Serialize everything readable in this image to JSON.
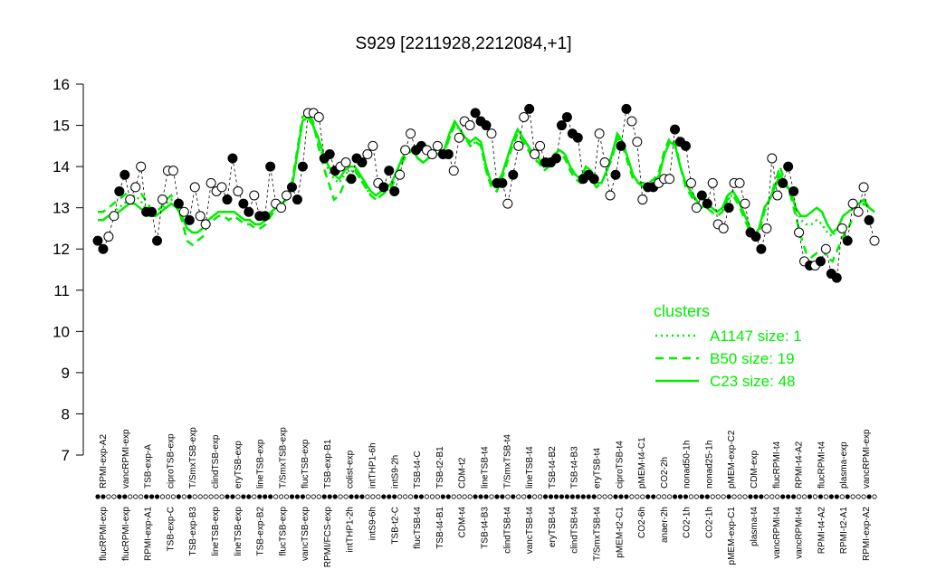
{
  "chart_data": {
    "type": "line",
    "title": "S929 [2211928,2212084,+1]",
    "xlabel": "",
    "ylabel": "",
    "ylim": [
      7,
      16
    ],
    "yticks": [
      7,
      8,
      9,
      10,
      11,
      12,
      13,
      14,
      15,
      16
    ],
    "grid": false,
    "legend_position": "right",
    "legend": {
      "title": "clusters",
      "items": [
        {
          "label": "A1147 size: 1",
          "style": "dotted"
        },
        {
          "label": "B50 size: 19",
          "style": "dashed"
        },
        {
          "label": "C23 size: 48",
          "style": "solid"
        }
      ]
    },
    "colors": {
      "line": "#00ee00",
      "text": "#000000",
      "point_filled": "#000000",
      "point_open": "#ffffff"
    },
    "top_tick_labels": [
      "RPMI-exp-A2",
      "vancRPMI-exp",
      "TSB-exp-A",
      "ciproTSB-exp",
      "T/SmxTSB-exp",
      "clindTSB-exp",
      "eryTSB-exp",
      "lineTSB-exp",
      "T/SmxTSB-exp",
      "flucTSB-exp",
      "TSB-exp-B1",
      "colist-exp",
      "intTHP1-6h",
      "intS9-2h",
      "TSB-t4-C",
      "TSB-t2-B1",
      "CDM-t2",
      "lineTSB-t4",
      "T/SmxTSB-t4",
      "lineTSB-t4",
      "TSB-t4-B2",
      "TSB-t4-B3",
      "eryTSB-t4",
      "ciproTSB-t4",
      "pMEM-t4-C1",
      "CO2-2h",
      "nonad50-1h",
      "nonad25-1h",
      "pMEM-exp-C2",
      "CDM-exp",
      "flucRPMI-t4",
      "RPMI-t4-A2",
      "flucRPMI-t4",
      "plasma-exp",
      "vancRPMI-exp"
    ],
    "bottom_tick_labels": [
      "flucRPMI-exp",
      "flucRPMI-exp",
      "RPMI-exp-A1",
      "TSB-exp-C",
      "TSB-exp-B3",
      "lineTSB-exp",
      "lineTSB-exp",
      "TSB-exp-B2",
      "flucTSB-exp",
      "vancTSB-exp",
      "RPMI/FCS-exp",
      "intTHP1-2h",
      "intS9-6h",
      "TSB-t2-C",
      "flucTSB-t4",
      "TSB-t4-B1",
      "CDM-t4",
      "TSB-t4-B3",
      "clindTSB-t4",
      "vancTSB-t4",
      "eryTSB-t4",
      "clindTSB-t4",
      "T/SmxTSB-t4",
      "pMEM-t2-C1",
      "CO2-6h",
      "anaer-2h",
      "CO2-1h",
      "CO2-1h",
      "pMEM-exp-C1",
      "plasma-t4",
      "vancRPMI-t4",
      "vancRPMI-t4",
      "RPMI-t4-A2",
      "RPMI-t2-A1",
      "RPMI-exp-A2"
    ],
    "points": [
      {
        "y": 12.2,
        "filled": true
      },
      {
        "y": 12.0,
        "filled": true
      },
      {
        "y": 12.3,
        "filled": false
      },
      {
        "y": 12.8,
        "filled": false
      },
      {
        "y": 13.4,
        "filled": true
      },
      {
        "y": 13.8,
        "filled": true
      },
      {
        "y": 13.2,
        "filled": false
      },
      {
        "y": 13.5,
        "filled": false
      },
      {
        "y": 14.0,
        "filled": false
      },
      {
        "y": 12.9,
        "filled": true
      },
      {
        "y": 12.9,
        "filled": true
      },
      {
        "y": 12.2,
        "filled": true
      },
      {
        "y": 13.2,
        "filled": false
      },
      {
        "y": 13.9,
        "filled": false
      },
      {
        "y": 13.9,
        "filled": false
      },
      {
        "y": 13.1,
        "filled": true
      },
      {
        "y": 12.9,
        "filled": false
      },
      {
        "y": 12.7,
        "filled": true
      },
      {
        "y": 13.5,
        "filled": false
      },
      {
        "y": 12.8,
        "filled": false
      },
      {
        "y": 12.6,
        "filled": false
      },
      {
        "y": 13.6,
        "filled": false
      },
      {
        "y": 13.4,
        "filled": false
      },
      {
        "y": 13.5,
        "filled": false
      },
      {
        "y": 13.2,
        "filled": true
      },
      {
        "y": 14.2,
        "filled": true
      },
      {
        "y": 13.4,
        "filled": false
      },
      {
        "y": 13.1,
        "filled": true
      },
      {
        "y": 12.9,
        "filled": true
      },
      {
        "y": 13.3,
        "filled": false
      },
      {
        "y": 12.8,
        "filled": true
      },
      {
        "y": 12.8,
        "filled": true
      },
      {
        "y": 14.0,
        "filled": true
      },
      {
        "y": 13.1,
        "filled": false
      },
      {
        "y": 13.0,
        "filled": false
      },
      {
        "y": 13.3,
        "filled": false
      },
      {
        "y": 13.5,
        "filled": true
      },
      {
        "y": 13.2,
        "filled": true
      },
      {
        "y": 14.0,
        "filled": true
      },
      {
        "y": 15.3,
        "filled": false
      },
      {
        "y": 15.3,
        "filled": false
      },
      {
        "y": 15.2,
        "filled": false
      },
      {
        "y": 14.2,
        "filled": true
      },
      {
        "y": 14.3,
        "filled": true
      },
      {
        "y": 13.9,
        "filled": true
      },
      {
        "y": 14.0,
        "filled": false
      },
      {
        "y": 14.1,
        "filled": false
      },
      {
        "y": 13.7,
        "filled": true
      },
      {
        "y": 14.2,
        "filled": true
      },
      {
        "y": 14.1,
        "filled": true
      },
      {
        "y": 14.3,
        "filled": false
      },
      {
        "y": 14.5,
        "filled": false
      },
      {
        "y": 13.6,
        "filled": false
      },
      {
        "y": 13.5,
        "filled": true
      },
      {
        "y": 13.9,
        "filled": true
      },
      {
        "y": 13.4,
        "filled": true
      },
      {
        "y": 13.8,
        "filled": false
      },
      {
        "y": 14.4,
        "filled": false
      },
      {
        "y": 14.8,
        "filled": false
      },
      {
        "y": 14.4,
        "filled": true
      },
      {
        "y": 14.5,
        "filled": true
      },
      {
        "y": 14.4,
        "filled": false
      },
      {
        "y": 14.3,
        "filled": false
      },
      {
        "y": 14.5,
        "filled": false
      },
      {
        "y": 14.3,
        "filled": true
      },
      {
        "y": 14.3,
        "filled": true
      },
      {
        "y": 13.9,
        "filled": false
      },
      {
        "y": 14.7,
        "filled": false
      },
      {
        "y": 15.1,
        "filled": false
      },
      {
        "y": 15.0,
        "filled": false
      },
      {
        "y": 15.3,
        "filled": true
      },
      {
        "y": 15.1,
        "filled": true
      },
      {
        "y": 15.0,
        "filled": true
      },
      {
        "y": 14.8,
        "filled": false
      },
      {
        "y": 13.6,
        "filled": true
      },
      {
        "y": 13.6,
        "filled": true
      },
      {
        "y": 13.1,
        "filled": false
      },
      {
        "y": 13.8,
        "filled": true
      },
      {
        "y": 14.5,
        "filled": false
      },
      {
        "y": 15.2,
        "filled": false
      },
      {
        "y": 15.4,
        "filled": true
      },
      {
        "y": 14.3,
        "filled": false
      },
      {
        "y": 14.5,
        "filled": false
      },
      {
        "y": 14.1,
        "filled": true
      },
      {
        "y": 14.1,
        "filled": true
      },
      {
        "y": 14.2,
        "filled": true
      },
      {
        "y": 15.0,
        "filled": true
      },
      {
        "y": 15.2,
        "filled": true
      },
      {
        "y": 14.8,
        "filled": true
      },
      {
        "y": 14.7,
        "filled": true
      },
      {
        "y": 13.7,
        "filled": true
      },
      {
        "y": 13.8,
        "filled": true
      },
      {
        "y": 13.7,
        "filled": true
      },
      {
        "y": 14.8,
        "filled": false
      },
      {
        "y": 14.1,
        "filled": false
      },
      {
        "y": 13.3,
        "filled": false
      },
      {
        "y": 13.8,
        "filled": true
      },
      {
        "y": 14.5,
        "filled": true
      },
      {
        "y": 15.4,
        "filled": true
      },
      {
        "y": 15.1,
        "filled": false
      },
      {
        "y": 14.6,
        "filled": false
      },
      {
        "y": 13.2,
        "filled": false
      },
      {
        "y": 13.5,
        "filled": true
      },
      {
        "y": 13.5,
        "filled": true
      },
      {
        "y": 13.6,
        "filled": false
      },
      {
        "y": 13.7,
        "filled": false
      },
      {
        "y": 13.7,
        "filled": false
      },
      {
        "y": 14.9,
        "filled": true
      },
      {
        "y": 14.6,
        "filled": true
      },
      {
        "y": 14.5,
        "filled": true
      },
      {
        "y": 13.6,
        "filled": false
      },
      {
        "y": 13.0,
        "filled": false
      },
      {
        "y": 13.3,
        "filled": true
      },
      {
        "y": 13.1,
        "filled": true
      },
      {
        "y": 13.6,
        "filled": false
      },
      {
        "y": 12.6,
        "filled": false
      },
      {
        "y": 12.5,
        "filled": false
      },
      {
        "y": 13.0,
        "filled": true
      },
      {
        "y": 13.6,
        "filled": false
      },
      {
        "y": 13.6,
        "filled": false
      },
      {
        "y": 13.1,
        "filled": false
      },
      {
        "y": 12.4,
        "filled": true
      },
      {
        "y": 12.3,
        "filled": true
      },
      {
        "y": 12.0,
        "filled": true
      },
      {
        "y": 12.5,
        "filled": false
      },
      {
        "y": 14.2,
        "filled": false
      },
      {
        "y": 13.3,
        "filled": false
      },
      {
        "y": 13.6,
        "filled": true
      },
      {
        "y": 14.0,
        "filled": true
      },
      {
        "y": 13.4,
        "filled": true
      },
      {
        "y": 12.4,
        "filled": false
      },
      {
        "y": 11.7,
        "filled": false
      },
      {
        "y": 11.6,
        "filled": true
      },
      {
        "y": 11.6,
        "filled": false
      },
      {
        "y": 11.7,
        "filled": true
      },
      {
        "y": 12.0,
        "filled": false
      },
      {
        "y": 11.4,
        "filled": true
      },
      {
        "y": 11.3,
        "filled": true
      },
      {
        "y": 12.5,
        "filled": false
      },
      {
        "y": 12.2,
        "filled": true
      },
      {
        "y": 13.1,
        "filled": false
      },
      {
        "y": 12.9,
        "filled": false
      },
      {
        "y": 13.5,
        "filled": false
      },
      {
        "y": 12.7,
        "filled": true
      },
      {
        "y": 12.2,
        "filled": false
      }
    ],
    "series": [
      {
        "style": "solid",
        "values": [
          12.7,
          12.7,
          12.8,
          12.8,
          12.9,
          13.0,
          13.1,
          13.1,
          13.0,
          12.9,
          12.8,
          12.8,
          12.9,
          13.0,
          13.1,
          13.0,
          12.8,
          12.5,
          12.4,
          12.4,
          12.5,
          12.7,
          12.8,
          12.9,
          12.9,
          12.9,
          12.9,
          12.8,
          12.7,
          12.7,
          12.6,
          12.6,
          12.7,
          12.9,
          13.0,
          13.1,
          13.2,
          13.5,
          14.3,
          15.1,
          15.2,
          15.0,
          14.7,
          14.3,
          14.0,
          13.8,
          13.7,
          13.9,
          14.0,
          14.0,
          13.8,
          13.6,
          13.4,
          13.3,
          13.4,
          13.5,
          13.6,
          13.9,
          14.2,
          14.4,
          14.4,
          14.2,
          14.1,
          14.2,
          14.3,
          14.3,
          14.4,
          14.8,
          15.1,
          14.9,
          14.7,
          14.6,
          14.7,
          14.6,
          14.0,
          13.6,
          13.6,
          13.8,
          14.2,
          14.6,
          14.9,
          14.7,
          14.5,
          14.3,
          14.2,
          14.0,
          14.1,
          14.3,
          14.4,
          14.3,
          14.0,
          13.8,
          13.7,
          14.0,
          13.9,
          13.6,
          13.6,
          13.9,
          14.3,
          14.8,
          14.6,
          14.2,
          13.8,
          13.6,
          13.5,
          13.5,
          13.6,
          13.8,
          14.3,
          14.6,
          14.5,
          14.0,
          13.6,
          13.4,
          13.2,
          13.0,
          13.1,
          13.0,
          12.9,
          13.0,
          13.3,
          13.4,
          13.2,
          12.9,
          12.6,
          12.3,
          12.5,
          13.0,
          13.2,
          13.5,
          13.8,
          13.6,
          13.4,
          13.0,
          12.8,
          12.8,
          12.9,
          13.0,
          12.9,
          12.6,
          12.4,
          12.5,
          12.8,
          12.9,
          13.0,
          13.1,
          13.2,
          13.0,
          12.9
        ]
      },
      {
        "style": "dashed",
        "values": [
          12.9,
          12.9,
          13.0,
          13.1,
          13.2,
          13.3,
          13.4,
          13.5,
          13.4,
          13.2,
          13.0,
          12.9,
          13.0,
          13.2,
          13.3,
          13.1,
          12.7,
          12.2,
          12.1,
          12.2,
          12.3,
          12.6,
          12.7,
          12.8,
          12.8,
          12.7,
          12.8,
          12.7,
          12.6,
          12.6,
          12.5,
          12.5,
          12.6,
          12.8,
          13.0,
          13.2,
          13.3,
          13.6,
          14.4,
          15.2,
          15.3,
          15.1,
          14.5,
          14.0,
          13.6,
          13.2,
          13.3,
          13.6,
          13.8,
          13.9,
          13.7,
          13.5,
          13.3,
          13.2,
          13.3,
          13.4,
          13.5,
          13.8,
          14.1,
          14.3,
          14.4,
          14.2,
          14.1,
          14.2,
          14.3,
          14.3,
          14.3,
          14.7,
          15.0,
          14.9,
          14.7,
          14.5,
          14.6,
          14.5,
          13.9,
          13.5,
          13.4,
          13.7,
          14.1,
          14.5,
          14.8,
          14.6,
          14.4,
          14.2,
          14.1,
          13.9,
          14.0,
          14.2,
          14.3,
          14.2,
          13.9,
          13.7,
          13.6,
          13.8,
          13.7,
          13.5,
          13.6,
          13.9,
          14.2,
          14.7,
          14.5,
          14.1,
          13.7,
          13.6,
          13.6,
          13.6,
          13.7,
          13.9,
          14.4,
          14.7,
          14.6,
          14.0,
          13.5,
          13.3,
          13.1,
          13.0,
          13.0,
          12.9,
          12.8,
          12.9,
          13.2,
          13.3,
          13.1,
          12.8,
          12.5,
          12.3,
          12.4,
          12.9,
          13.2,
          13.6,
          14.0,
          13.6,
          13.3,
          12.8,
          12.3,
          11.9,
          11.8,
          11.9,
          12.0,
          11.8,
          11.7,
          12.0,
          12.3,
          12.5,
          12.8,
          13.0,
          13.1,
          13.0,
          12.9
        ]
      },
      {
        "style": "dotted",
        "values": [
          12.7,
          12.7,
          12.8,
          12.9,
          13.0,
          13.1,
          13.2,
          13.3,
          13.2,
          13.0,
          12.9,
          12.8,
          12.9,
          13.1,
          13.2,
          13.0,
          12.8,
          12.5,
          12.4,
          12.4,
          12.5,
          12.7,
          12.8,
          12.9,
          12.9,
          12.9,
          12.9,
          12.8,
          12.7,
          12.7,
          12.6,
          12.6,
          12.7,
          12.9,
          13.0,
          13.1,
          13.2,
          13.5,
          14.3,
          15.1,
          15.2,
          15.0,
          14.6,
          14.2,
          13.9,
          13.7,
          13.6,
          13.8,
          13.9,
          13.9,
          13.7,
          13.5,
          13.3,
          13.2,
          13.3,
          13.4,
          13.6,
          13.9,
          14.2,
          14.4,
          14.4,
          14.2,
          14.1,
          14.2,
          14.3,
          14.3,
          14.3,
          14.7,
          15.0,
          14.9,
          14.7,
          14.5,
          14.6,
          14.5,
          13.9,
          13.5,
          13.5,
          13.8,
          14.2,
          14.6,
          14.9,
          14.7,
          14.5,
          14.3,
          14.2,
          14.0,
          14.1,
          14.3,
          14.4,
          14.3,
          14.0,
          13.8,
          13.7,
          14.0,
          13.9,
          13.6,
          13.6,
          13.9,
          14.3,
          14.8,
          14.6,
          14.2,
          13.8,
          13.6,
          13.5,
          13.5,
          13.6,
          13.8,
          14.3,
          14.6,
          14.5,
          14.0,
          13.6,
          13.4,
          13.2,
          13.0,
          13.1,
          13.0,
          12.9,
          13.0,
          13.3,
          13.4,
          13.2,
          12.9,
          12.6,
          12.3,
          12.5,
          13.0,
          13.2,
          13.5,
          13.8,
          13.6,
          13.4,
          13.0,
          12.7,
          12.6,
          12.6,
          12.7,
          12.6,
          12.4,
          12.3,
          12.5,
          12.8,
          12.9,
          13.0,
          13.1,
          13.2,
          13.0,
          12.9
        ]
      }
    ]
  }
}
